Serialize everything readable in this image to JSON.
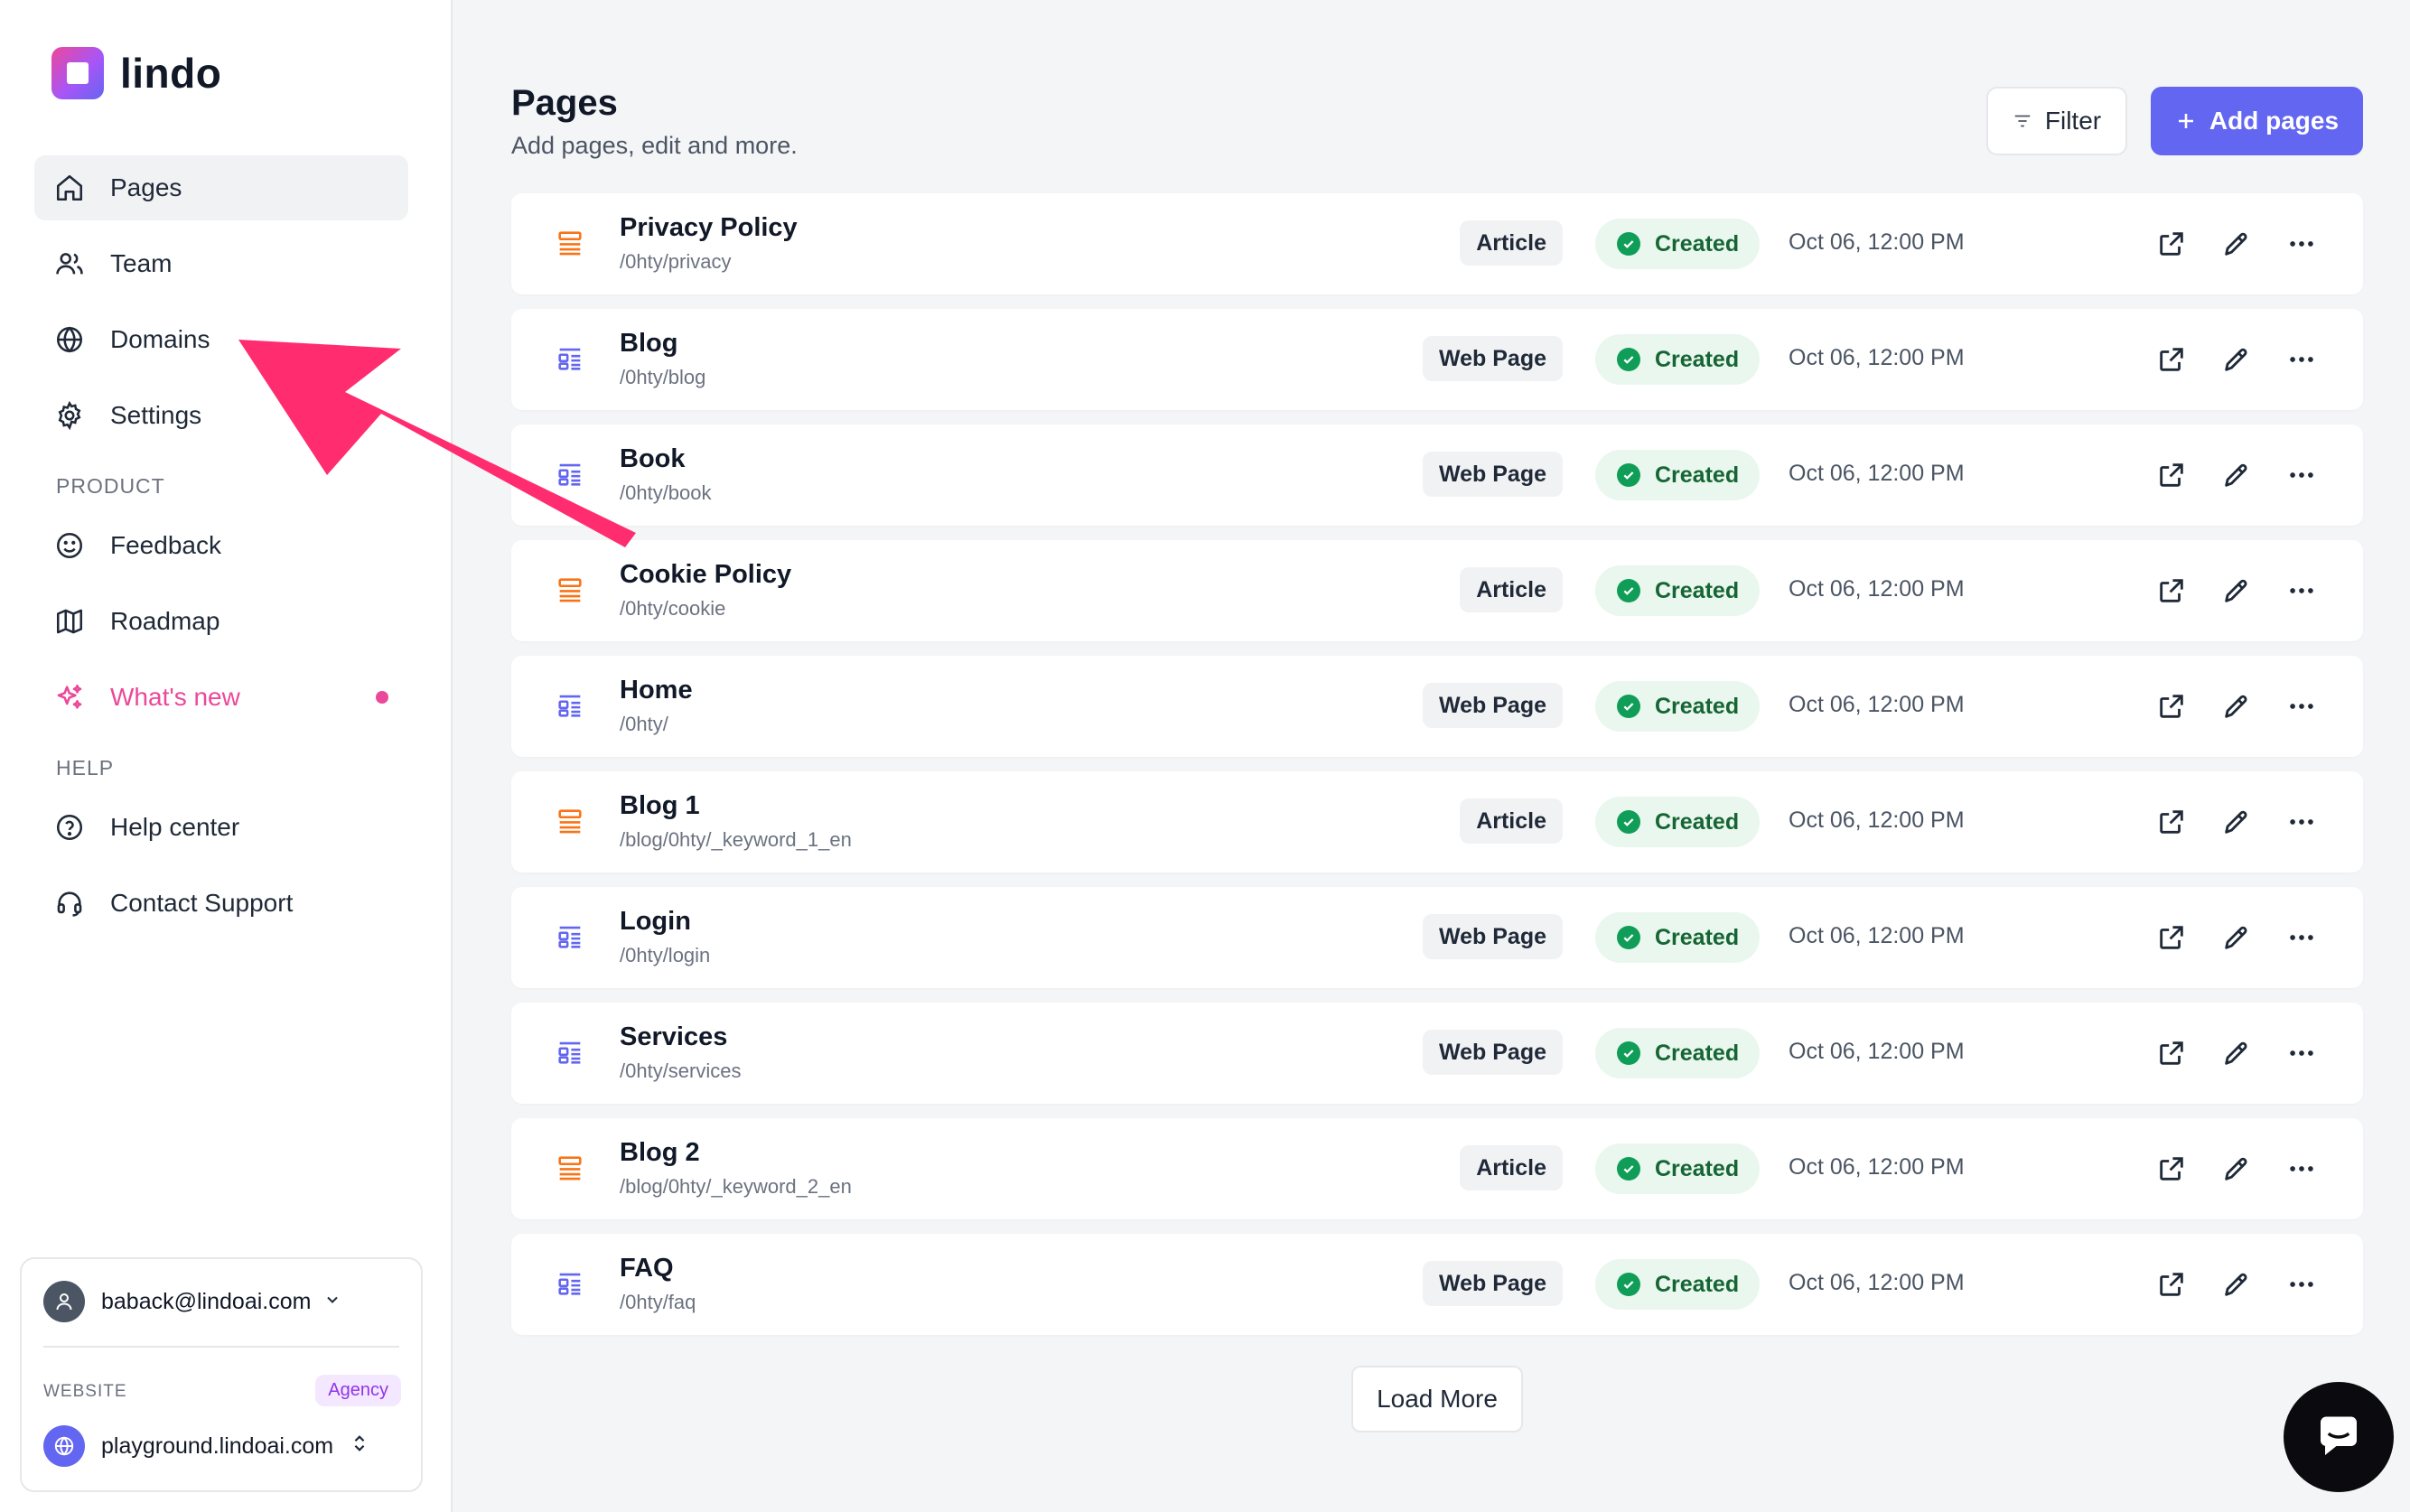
{
  "app": {
    "logo_text": "lindo",
    "brand_color": "#6366f1",
    "accent_pink": "#ec4899"
  },
  "sidebar": {
    "nav": [
      {
        "label": "Pages",
        "icon": "home-icon",
        "active": true
      },
      {
        "label": "Team",
        "icon": "users-icon"
      },
      {
        "label": "Domains",
        "icon": "globe-icon"
      },
      {
        "label": "Settings",
        "icon": "gear-icon"
      }
    ],
    "product_heading": "PRODUCT",
    "product": [
      {
        "label": "Feedback",
        "icon": "smile-icon"
      },
      {
        "label": "Roadmap",
        "icon": "map-icon"
      },
      {
        "label": "What's new",
        "icon": "sparkles-icon",
        "has_dot": true
      }
    ],
    "help_heading": "HELP",
    "help": [
      {
        "label": "Help center",
        "icon": "question-circle-icon"
      },
      {
        "label": "Contact Support",
        "icon": "headset-icon"
      }
    ],
    "account": {
      "email": "baback@lindoai.com",
      "website_label": "WEBSITE",
      "plan_badge": "Agency",
      "site": "playground.lindoai.com"
    }
  },
  "main": {
    "title": "Pages",
    "subtitle": "Add pages, edit and more.",
    "filter_label": "Filter",
    "add_label": "Add pages",
    "load_more_label": "Load More",
    "status_color": "#0f9d58",
    "pages": [
      {
        "title": "Privacy Policy",
        "path": "/0hty/privacy",
        "type": "Article",
        "status": "Created",
        "date": "Oct 06, 12:00 PM"
      },
      {
        "title": "Blog",
        "path": "/0hty/blog",
        "type": "Web Page",
        "status": "Created",
        "date": "Oct 06, 12:00 PM"
      },
      {
        "title": "Book",
        "path": "/0hty/book",
        "type": "Web Page",
        "status": "Created",
        "date": "Oct 06, 12:00 PM"
      },
      {
        "title": "Cookie Policy",
        "path": "/0hty/cookie",
        "type": "Article",
        "status": "Created",
        "date": "Oct 06, 12:00 PM"
      },
      {
        "title": "Home",
        "path": "/0hty/",
        "type": "Web Page",
        "status": "Created",
        "date": "Oct 06, 12:00 PM"
      },
      {
        "title": "Blog 1",
        "path": "/blog/0hty/_keyword_1_en",
        "type": "Article",
        "status": "Created",
        "date": "Oct 06, 12:00 PM"
      },
      {
        "title": "Login",
        "path": "/0hty/login",
        "type": "Web Page",
        "status": "Created",
        "date": "Oct 06, 12:00 PM"
      },
      {
        "title": "Services",
        "path": "/0hty/services",
        "type": "Web Page",
        "status": "Created",
        "date": "Oct 06, 12:00 PM"
      },
      {
        "title": "Blog 2",
        "path": "/blog/0hty/_keyword_2_en",
        "type": "Article",
        "status": "Created",
        "date": "Oct 06, 12:00 PM"
      },
      {
        "title": "FAQ",
        "path": "/0hty/faq",
        "type": "Web Page",
        "status": "Created",
        "date": "Oct 06, 12:00 PM"
      }
    ]
  },
  "annotation": {
    "arrow_color": "#ff2d6f"
  }
}
